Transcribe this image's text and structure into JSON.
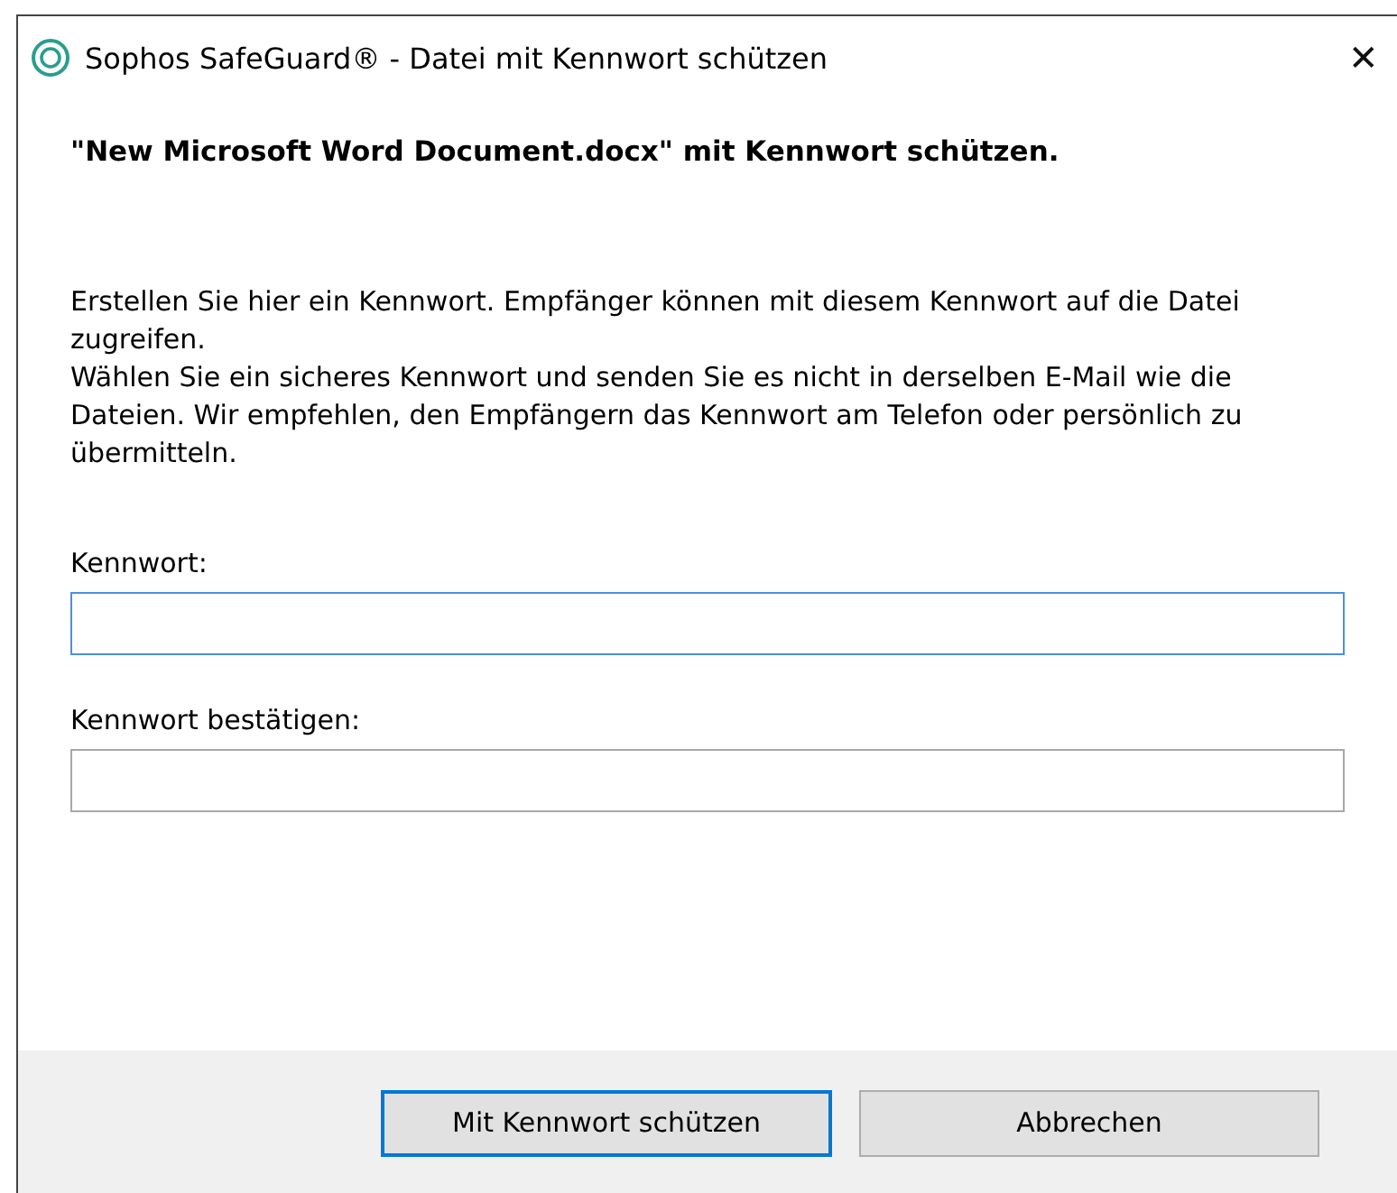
{
  "window": {
    "title": "Sophos SafeGuard® - Datei mit Kennwort schützen",
    "close": "✕"
  },
  "heading": "\"New Microsoft Word Document.docx\" mit Kennwort schützen.",
  "paragraphs": [
    "Erstellen Sie hier ein Kennwort. Empfänger können mit diesem Kennwort auf die Datei zugreifen.",
    "Wählen Sie ein sicheres Kennwort und senden Sie es nicht in derselben E-Mail wie die Dateien. Wir empfehlen, den Empfängern das Kennwort am Telefon oder persönlich zu übermitteln."
  ],
  "fields": [
    {
      "label": "Kennwort:",
      "focused": true
    },
    {
      "label": "Kennwort bestätigen:",
      "focused": false
    }
  ],
  "buttons": [
    {
      "label": "Mit Kennwort schützen",
      "default": true
    },
    {
      "label": "Abbrechen",
      "default": false
    }
  ]
}
